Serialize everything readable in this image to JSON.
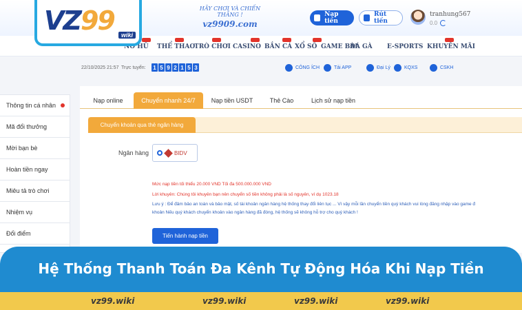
{
  "header": {
    "slogan_line1": "HÃY CHƠI VÀ CHIẾN THẮNG !",
    "slogan_domain": "vz9909.com",
    "deposit_label": "Nạp tiền",
    "withdraw_label": "Rút tiền",
    "username": "tranhung567",
    "balance": "0.0",
    "logo_main": "VZ",
    "logo_num": "99",
    "logo_sub": "wiki"
  },
  "nav": {
    "items": [
      {
        "label": "NỔ HŨ",
        "hot": true
      },
      {
        "label": "THỂ THAO",
        "hot": true
      },
      {
        "label": "TRÒ CHƠI",
        "hot": true
      },
      {
        "label": "CASINO",
        "hot": true
      },
      {
        "label": "BẮN CÁ",
        "hot": true
      },
      {
        "label": "XỔ SỐ",
        "hot": true
      },
      {
        "label": "GAME BÀI",
        "hot": false
      },
      {
        "label": "ĐÁ GÀ",
        "hot": false
      },
      {
        "label": "E-SPORTS",
        "hot": false
      },
      {
        "label": "KHUYẾN MÃI",
        "hot": true
      }
    ]
  },
  "infobar": {
    "datetime": "22/10/2025 21:57",
    "online_label": "Trực tuyến:",
    "online_digits": [
      "1",
      "5",
      "9",
      "2",
      "1",
      "5",
      "3"
    ],
    "links": [
      {
        "label": "CÔNG ÍCH",
        "icon": "charity-icon"
      },
      {
        "label": "Tải APP",
        "icon": "app-download-icon"
      },
      {
        "label": "Đại Lý",
        "icon": "agent-icon"
      },
      {
        "label": "KQXS",
        "icon": "lottery-result-icon"
      },
      {
        "label": "CSKH",
        "icon": "support-icon"
      }
    ]
  },
  "sidebar": {
    "items": [
      {
        "label": "Thông tin cá nhân",
        "dot": true
      },
      {
        "label": "Mã đổi thưởng",
        "dot": false
      },
      {
        "label": "Mời bạn bè",
        "dot": false
      },
      {
        "label": "Hoàn tiền ngay",
        "dot": false
      },
      {
        "label": "Miêu tả trò chơi",
        "dot": false
      },
      {
        "label": "Nhiệm vụ",
        "dot": false
      },
      {
        "label": "Đổi điểm",
        "dot": false
      }
    ]
  },
  "deposit": {
    "tabs": [
      "Nạp online",
      "Chuyển nhanh 24/7",
      "Nạp tiền USDT",
      "Thẻ Cào",
      "Lịch sử nạp tiền"
    ],
    "active_tab": 1,
    "subtab": "Chuyển khoản qua thẻ ngân hàng",
    "bank_label": "Ngân hàng",
    "bank_selected": "BIDV",
    "notice_limit": "Mức nạp tiền tối thiểu 20.000 VND Tối đa 500.000.000 VND",
    "notice_advice": "Lời khuyên: Chúng tôi khuyên bạn nên chuyển số tiền không phải là số nguyên, ví dụ 1023.18",
    "notice_note1": "Lưu ý : Để đảm bảo an toàn và bảo mật, số tài khoản ngân hàng hệ thống thay đổi liên tục ... Vì vậy mỗi lần chuyển tiền quý khách vui lòng đăng nhập vào game đ",
    "notice_note2": "khoản Nếu quý khách chuyển khoản vào ngân hàng đã đóng, hệ thống sẽ không hỗ trợ cho quý khách !",
    "submit_label": "Tiến hành nạp tiền"
  },
  "banner": {
    "title": "Hệ Thống Thanh Toán Đa Kênh Tự Động Hóa Khi Nạp Tiền",
    "footer_links": [
      "vz99.wiki",
      "vz99.wiki",
      "vz99.wiki",
      "vz99.wiki"
    ]
  },
  "colors": {
    "primary": "#1f63d9",
    "accent_orange": "#f2a93b",
    "banner_blue": "#1f8bd0",
    "footer_yellow": "#f2c94c",
    "alert_red": "#e2342b"
  }
}
